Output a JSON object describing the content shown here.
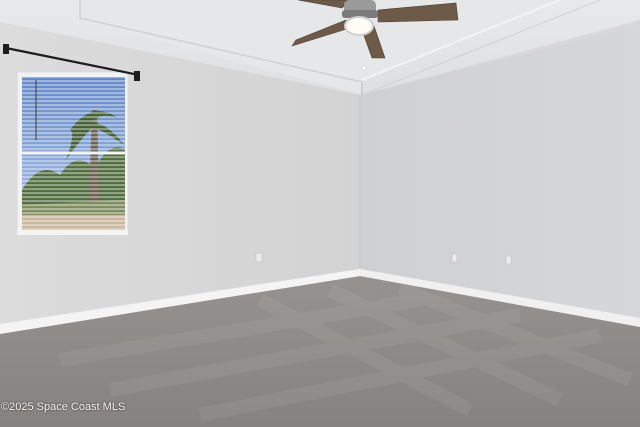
{
  "photo": {
    "watermark": "©2025 Space Coast MLS",
    "colors": {
      "left_wall": "#d9d9d9",
      "back_wall": "#d3d4d6",
      "ceiling": "#e3e4e6",
      "carpet": "#8f8b88",
      "baseboard": "#f4f4f4",
      "fan_blade": "#6e5a48",
      "curtain_rod": "#1e1e1e"
    },
    "icons": {
      "fan": "ceiling-fan-icon",
      "window": "window-icon",
      "outlet": "outlet-icon"
    }
  }
}
